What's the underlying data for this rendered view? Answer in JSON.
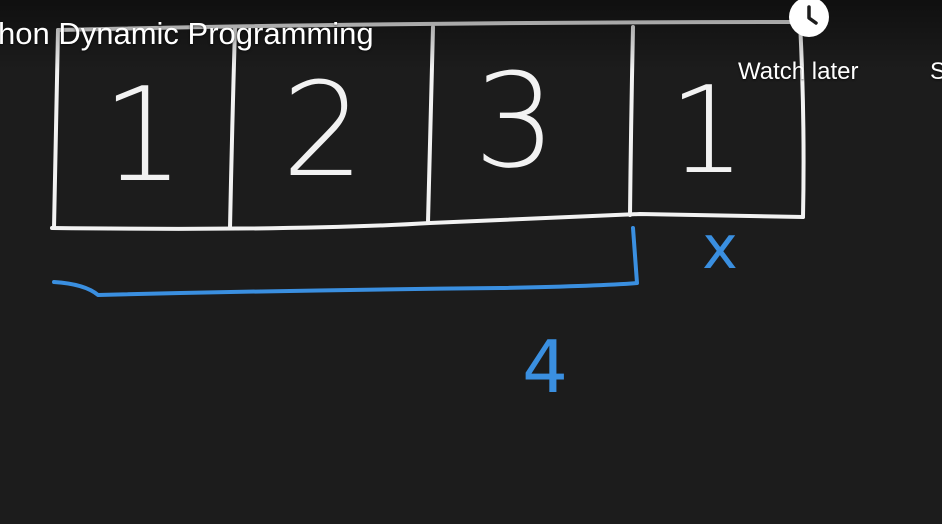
{
  "overlay": {
    "title": "hon Dynamic Programming",
    "watch_later_label": "Watch later",
    "share_label_partial": "S",
    "icons": {
      "watch_later": "clock-icon"
    }
  },
  "whiteboard": {
    "array_cells": [
      "1",
      "2",
      "3",
      "1"
    ],
    "bracket_label": "4",
    "mark_label": "x",
    "colors": {
      "background": "#1c1c1c",
      "chalk": "#f2f2f2",
      "bracket": "#3a8fe0"
    }
  }
}
